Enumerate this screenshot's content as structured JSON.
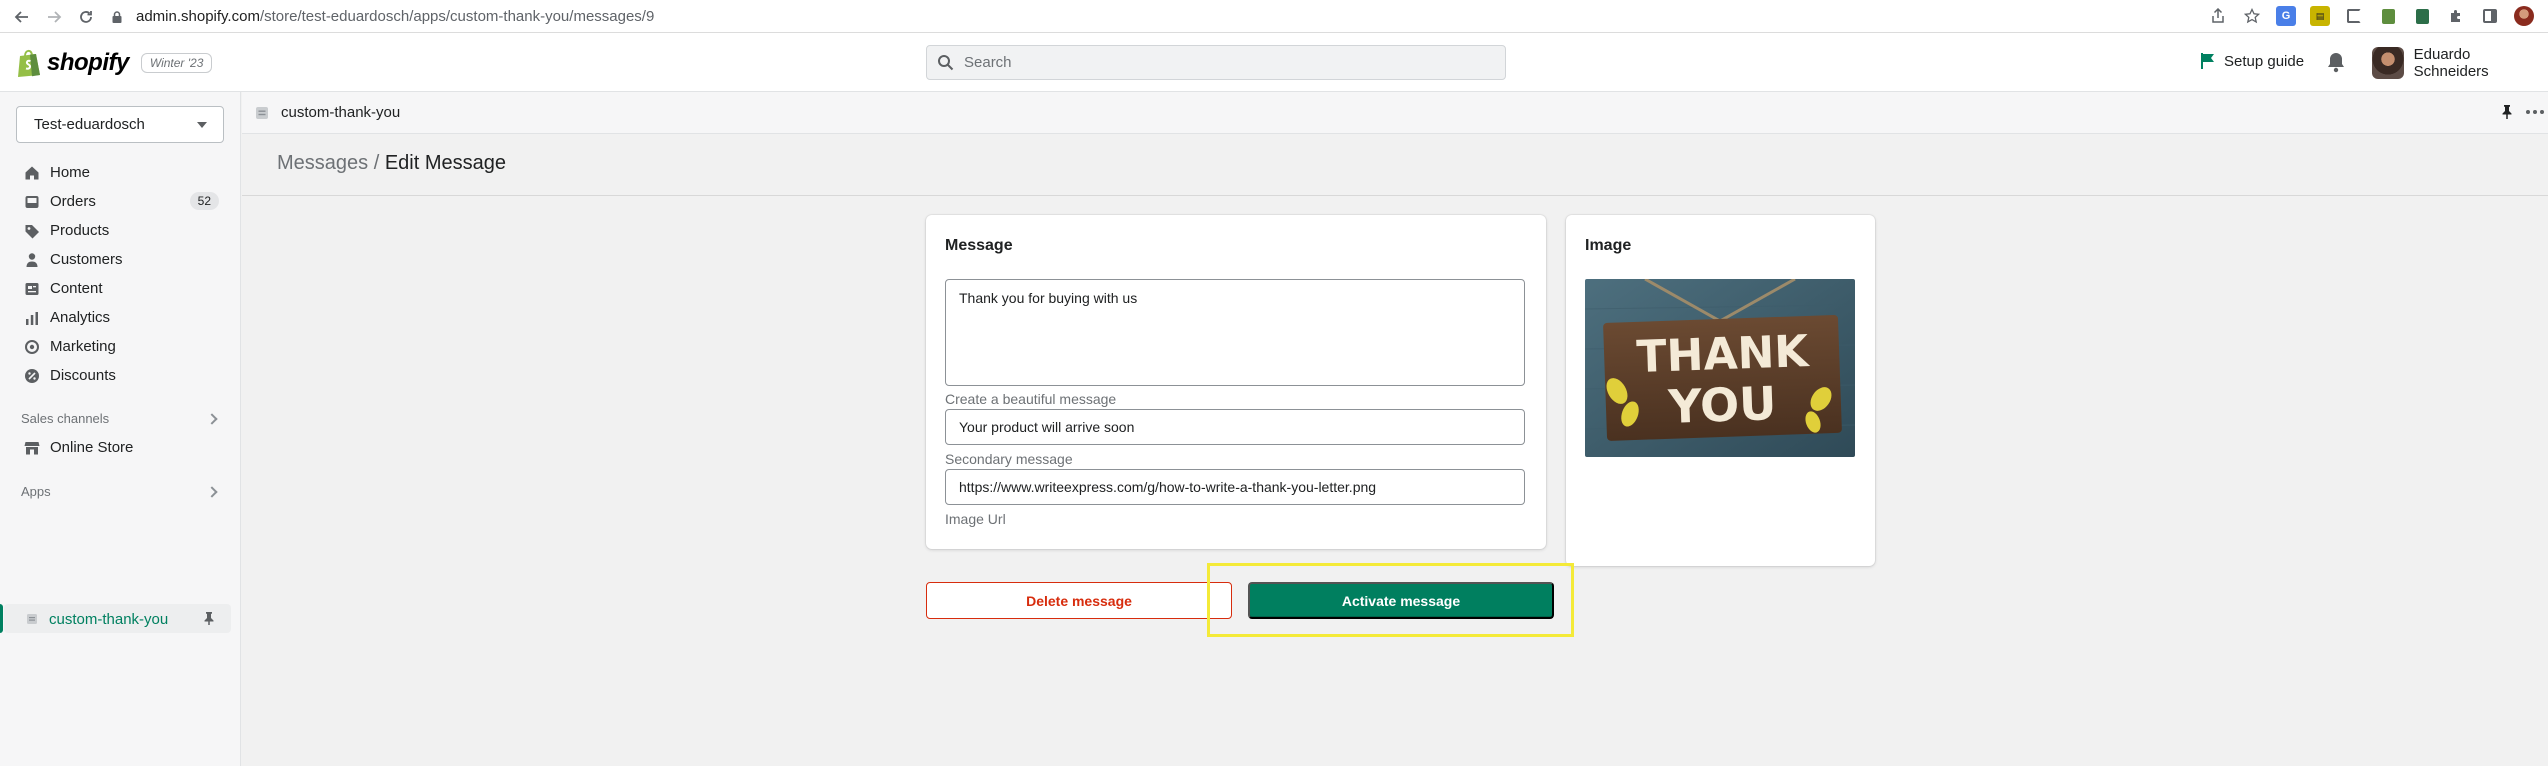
{
  "browser": {
    "url_host": "admin.shopify.com",
    "url_path": "/store/test-eduardosch/apps/custom-thank-you/messages/9"
  },
  "topbar": {
    "logo_text": "shopify",
    "edition_badge": "Winter '23",
    "search_placeholder": "Search",
    "setup_guide": "Setup guide",
    "user_name": "Eduardo Schneiders"
  },
  "sidebar": {
    "store_name": "Test-eduardosch",
    "nav": [
      {
        "label": "Home",
        "icon": "home-icon"
      },
      {
        "label": "Orders",
        "icon": "orders-icon",
        "badge": "52"
      },
      {
        "label": "Products",
        "icon": "tag-icon"
      },
      {
        "label": "Customers",
        "icon": "person-icon"
      },
      {
        "label": "Content",
        "icon": "content-icon"
      },
      {
        "label": "Analytics",
        "icon": "bar-chart-icon"
      },
      {
        "label": "Marketing",
        "icon": "target-icon"
      },
      {
        "label": "Discounts",
        "icon": "discount-icon"
      }
    ],
    "sales_channels_label": "Sales channels",
    "online_store": "Online Store",
    "apps_label": "Apps",
    "active_app": "custom-thank-you"
  },
  "appbar": {
    "title": "custom-thank-you"
  },
  "page": {
    "breadcrumb_parent": "Messages",
    "breadcrumb_separator": "/",
    "breadcrumb_current": "Edit Message"
  },
  "message_card": {
    "title": "Message",
    "main_message": "Thank you for buying with us",
    "main_help": "Create a beautiful message",
    "secondary_value": "Your product will arrive soon",
    "secondary_help": "Secondary message",
    "image_url_value": "https://www.writeexpress.com/g/how-to-write-a-thank-you-letter.png",
    "image_url_help": "Image Url"
  },
  "image_card": {
    "title": "Image",
    "image_text_line1": "THANK",
    "image_text_line2": "YOU"
  },
  "actions": {
    "delete_label": "Delete message",
    "activate_label": "Activate message"
  },
  "colors": {
    "primary_green": "#007f5f",
    "critical_red": "#d72c0d",
    "highlight_yellow": "#f4ea38"
  }
}
